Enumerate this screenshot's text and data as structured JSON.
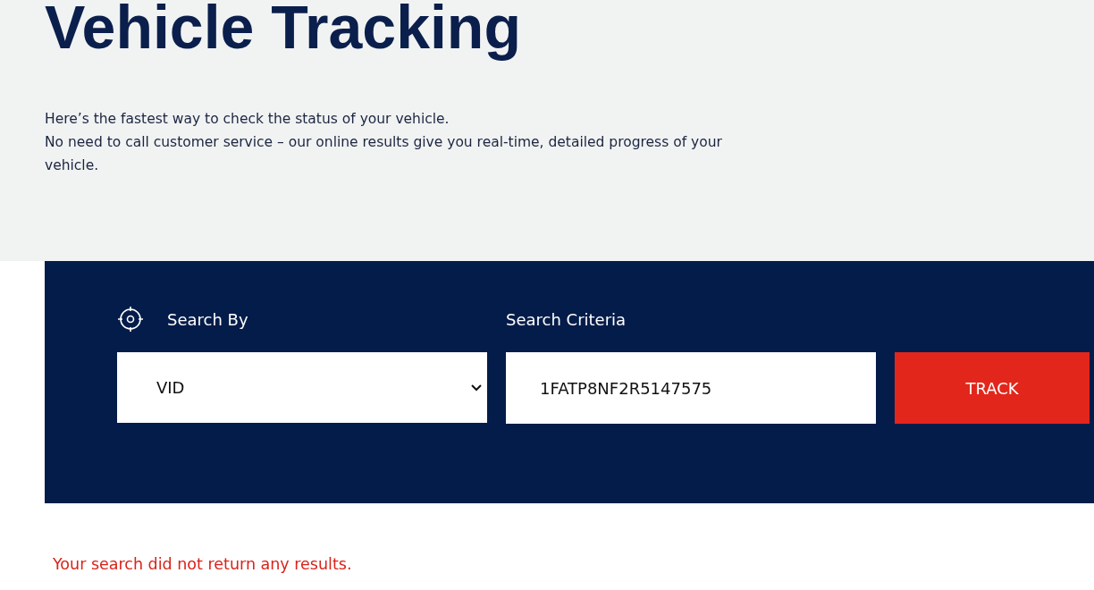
{
  "title": "Vehicle Tracking",
  "intro": [
    "Here’s the fastest way to check the status of your vehicle.",
    "No need to call customer service – our online results give you real-time, detailed progress of your vehicle."
  ],
  "search": {
    "search_by_label": "Search By",
    "search_by_value": "VID",
    "criteria_label": "Search Criteria",
    "criteria_value": "1FATP8NF2R5147575",
    "button": "TRACK"
  },
  "error": "Your search did not return any results."
}
